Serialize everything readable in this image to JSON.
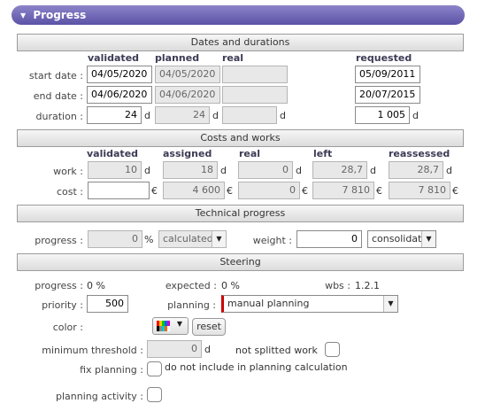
{
  "header": {
    "title": "Progress"
  },
  "dates": {
    "section_title": "Dates and durations",
    "col_validated": "validated",
    "col_planned": "planned",
    "col_real": "real",
    "col_requested": "requested",
    "start_label": "start date :",
    "end_label": "end date :",
    "duration_label": "duration :",
    "start_validated": "04/05/2020",
    "start_planned": "04/05/2020",
    "start_real": "",
    "start_requested": "05/09/2011",
    "end_validated": "04/06/2020",
    "end_planned": "04/06/2020",
    "end_real": "",
    "end_requested": "20/07/2015",
    "duration_validated": "24",
    "duration_planned": "24",
    "duration_real": "",
    "duration_requested": "1 005",
    "unit_d": "d"
  },
  "costs": {
    "section_title": "Costs and works",
    "col_validated": "validated",
    "col_assigned": "assigned",
    "col_real": "real",
    "col_left": "left",
    "col_reassessed": "reassessed",
    "work_label": "work :",
    "cost_label": "cost :",
    "work_validated": "10",
    "work_assigned": "18",
    "work_real": "0",
    "work_left": "28,7",
    "work_reassessed": "28,7",
    "cost_validated": "",
    "cost_assigned": "4 600",
    "cost_real": "0",
    "cost_left": "7 810",
    "cost_reassessed": "7 810",
    "unit_d": "d",
    "unit_euro": "€"
  },
  "technical": {
    "section_title": "Technical progress",
    "progress_label": "progress :",
    "progress_value": "0",
    "percent": "%",
    "progress_mode": "calculated",
    "weight_label": "weight :",
    "weight_value": "0",
    "weight_mode": "consolidat"
  },
  "steering": {
    "section_title": "Steering",
    "progress_label": "progress :",
    "progress_value": "0 %",
    "expected_label": "expected :",
    "expected_value": "0 %",
    "wbs_label": "wbs :",
    "wbs_value": "1.2.1",
    "priority_label": "priority :",
    "priority_value": "500",
    "planning_label": "planning :",
    "planning_value": "manual planning",
    "color_label": "color :",
    "reset_label": "reset",
    "min_threshold_label": "minimum threshold :",
    "min_threshold_value": "0",
    "unit_d": "d",
    "not_splitted_label": "not splitted work",
    "fix_planning_label": "fix planning :",
    "fix_planning_text": "do not include in planning calculation",
    "planning_activity_label": "planning activity :"
  },
  "colors": {
    "header_top": "#8c84c9",
    "header_bottom": "#5b52a6",
    "planning_marker": "#cc0000"
  },
  "icons": [
    "chevron-down-icon",
    "color-palette-icon",
    "dropdown-arrow-icon"
  ]
}
